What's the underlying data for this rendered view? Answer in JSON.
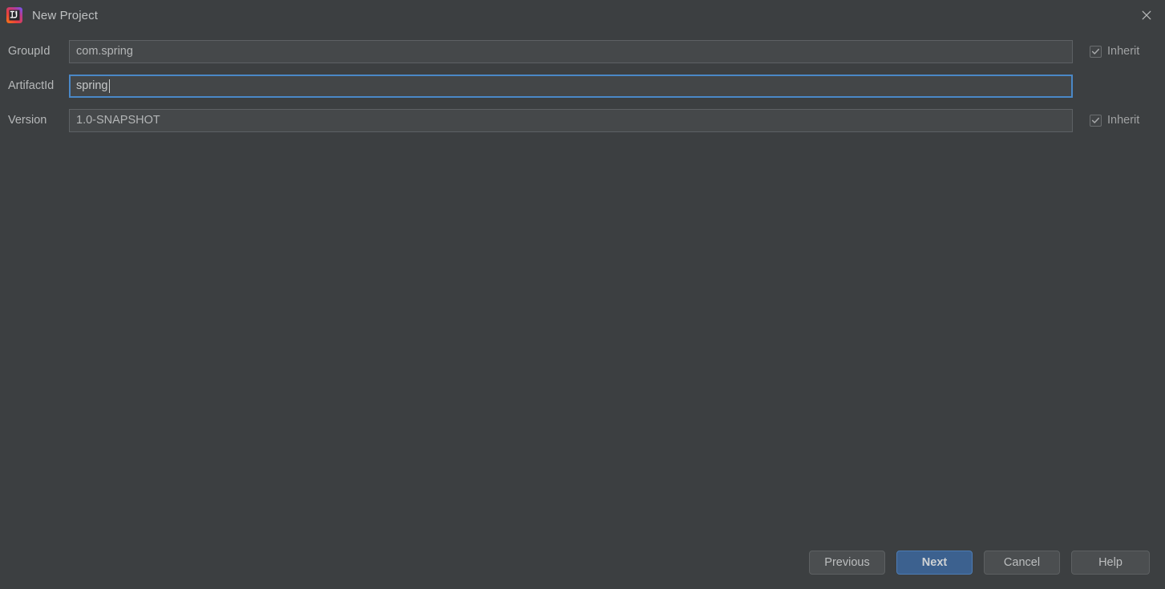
{
  "window": {
    "title": "New Project",
    "app_icon": "intellij-idea-icon",
    "close_icon": "close-icon"
  },
  "form": {
    "fields": [
      {
        "label": "GroupId",
        "value": "com.spring",
        "placeholder": "",
        "focused": false,
        "inherit": {
          "label": "Inherit",
          "checked": true
        }
      },
      {
        "label": "ArtifactId",
        "value": "spring",
        "placeholder": "",
        "focused": true,
        "inherit": null
      },
      {
        "label": "Version",
        "value": "1.0-SNAPSHOT",
        "placeholder": "",
        "focused": false,
        "inherit": {
          "label": "Inherit",
          "checked": true
        }
      }
    ]
  },
  "footer": {
    "previous_label": "Previous",
    "next_label": "Next",
    "cancel_label": "Cancel",
    "help_label": "Help"
  },
  "colors": {
    "background": "#3c3f41",
    "field_background": "#45484a",
    "field_border": "#5d6164",
    "focus_border": "#4a88c7",
    "primary_button": "#3c618f",
    "primary_button_border": "#4d7cb4",
    "button_background": "#4b4e50",
    "text": "#b6b8b9"
  }
}
